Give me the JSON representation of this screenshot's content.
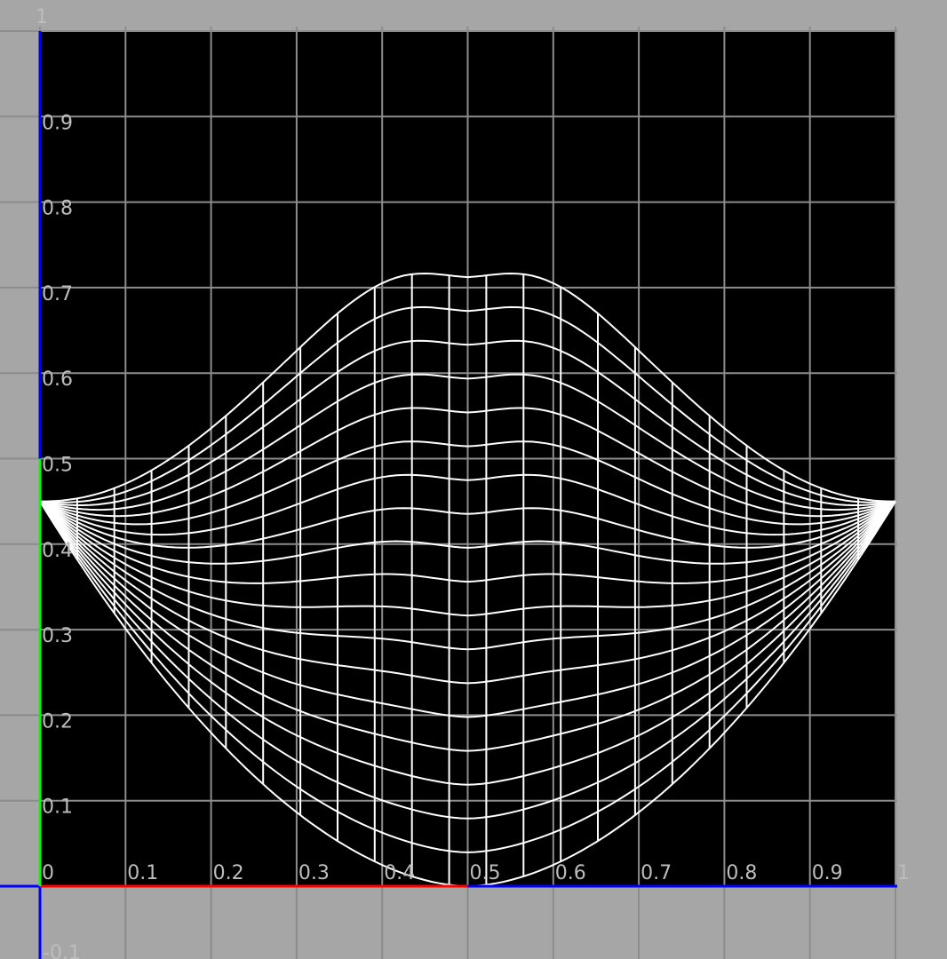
{
  "uv_editor": {
    "colors": {
      "viewport_background": "#a6a6a6",
      "uv_space_background": "#000000",
      "grid_line": "#8c8c8c",
      "mesh_wire": "#ffffff",
      "u_axis": "#ff0000",
      "v_axis": "#00ff00",
      "outer_axis": "#0000ff",
      "label_text": "#bdbdbd"
    },
    "grid": {
      "u_tick_labels": [
        "0",
        "0.1",
        "0.2",
        "0.3",
        "0.4",
        "0.5",
        "0.6",
        "0.7",
        "0.8",
        "0.9",
        "1"
      ],
      "v_tick_labels": [
        "0.1",
        "0.2",
        "0.3",
        "0.4",
        "0.5",
        "0.6",
        "0.7",
        "0.8",
        "0.9"
      ],
      "top_label": "1",
      "below_label": "-0.1"
    },
    "mesh": {
      "shape": "lips-uv-shell",
      "top_peak_v": 0.725,
      "center_dip_v": 0.71,
      "side_v": 0.45,
      "bottom_v": 0.0
    }
  }
}
